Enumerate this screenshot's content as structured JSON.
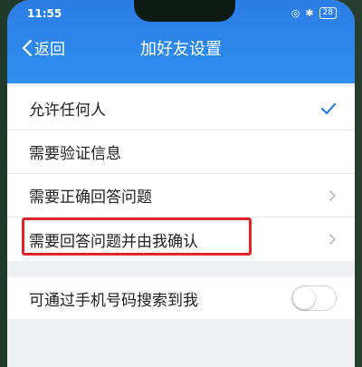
{
  "status_bar": {
    "time": "11:55",
    "battery": "28"
  },
  "nav": {
    "back_label": "返回",
    "title": "加好友设置"
  },
  "options": [
    {
      "label": "允许任何人",
      "selected": true
    },
    {
      "label": "需要验证信息",
      "selected": false
    },
    {
      "label": "需要正确回答问题",
      "has_arrow": true
    },
    {
      "label": "需要回答问题并由我确认",
      "has_arrow": true
    }
  ],
  "phone_search": {
    "label": "可通过手机号码搜索到我",
    "enabled": false
  },
  "colors": {
    "header": "#2f8ff0",
    "check": "#2c7de6",
    "highlight": "#e0242b"
  }
}
